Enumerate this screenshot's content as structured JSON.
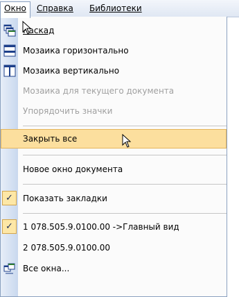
{
  "menubar": {
    "items": [
      {
        "label": "Окно"
      },
      {
        "label": "Справка"
      },
      {
        "label": "Библиотеки"
      }
    ]
  },
  "menu": {
    "items": [
      {
        "label": "Каскад",
        "icon": "cascade-windows-icon",
        "disabled": false
      },
      {
        "label": "Мозаика горизонтально",
        "icon": "tile-horizontal-icon",
        "disabled": false
      },
      {
        "label": "Мозаика вертикально",
        "icon": "tile-vertical-icon",
        "disabled": false
      },
      {
        "label": "Мозаика для текущего документа",
        "icon": "",
        "disabled": true
      },
      {
        "label": "Упорядочить значки",
        "icon": "",
        "disabled": true
      },
      {
        "label": "Закрыть все",
        "icon": "",
        "disabled": false,
        "highlighted": true
      },
      {
        "label": "Новое окно документа",
        "icon": "",
        "disabled": false
      },
      {
        "label": "Показать закладки",
        "icon": "check-icon",
        "checked": true
      },
      {
        "label": "1 078.505.9.0100.00 ->Главный вид",
        "icon": "check-icon",
        "checked": true
      },
      {
        "label": "2 078.505.9.0100.00",
        "icon": "",
        "checked": false
      },
      {
        "label": "Все окна...",
        "icon": "all-windows-icon",
        "disabled": false
      }
    ]
  },
  "colors": {
    "highlight": "#fcdf9e",
    "disabled_text": "#a0a0a0",
    "gutter": "#c9d8ee"
  }
}
